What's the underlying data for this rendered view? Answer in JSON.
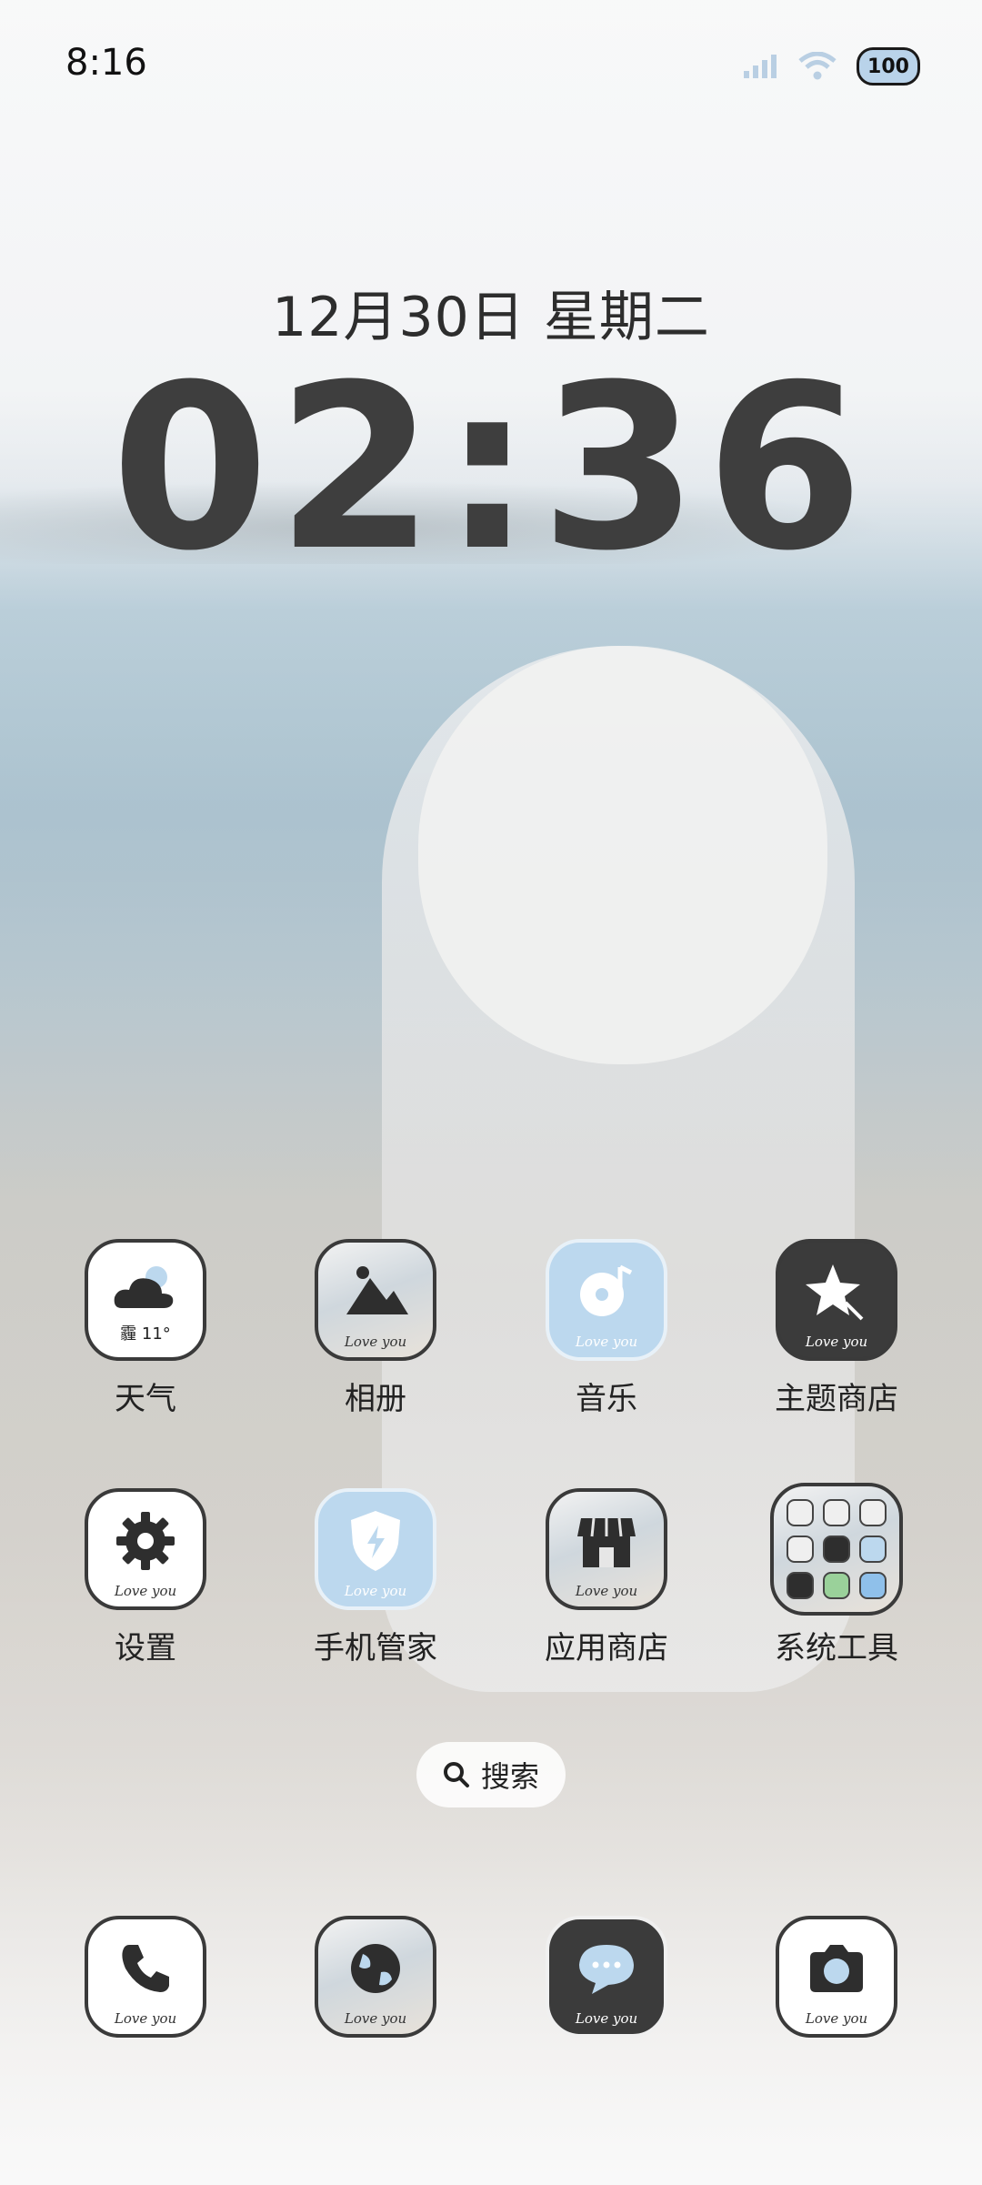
{
  "status_bar": {
    "time": "8:16",
    "battery": "100"
  },
  "clock": {
    "date": "12月30日 星期二",
    "time": "02:36"
  },
  "weather": {
    "condition": "霾",
    "temperature": "11°"
  },
  "icon_caption": "Love you",
  "apps": [
    {
      "label": "天气",
      "icon": "cloud-icon"
    },
    {
      "label": "相册",
      "icon": "mountain-icon"
    },
    {
      "label": "音乐",
      "icon": "music-disc-icon"
    },
    {
      "label": "主题商店",
      "icon": "star-wand-icon"
    },
    {
      "label": "设置",
      "icon": "gear-icon"
    },
    {
      "label": "手机管家",
      "icon": "shield-bolt-icon"
    },
    {
      "label": "应用商店",
      "icon": "store-icon"
    },
    {
      "label": "系统工具",
      "icon": "folder-icon"
    }
  ],
  "search": {
    "label": "搜索"
  },
  "dock": [
    {
      "name": "phone",
      "icon": "phone-icon"
    },
    {
      "name": "browser",
      "icon": "globe-icon"
    },
    {
      "name": "messages",
      "icon": "chat-bubble-icon"
    },
    {
      "name": "camera",
      "icon": "camera-icon"
    }
  ]
}
